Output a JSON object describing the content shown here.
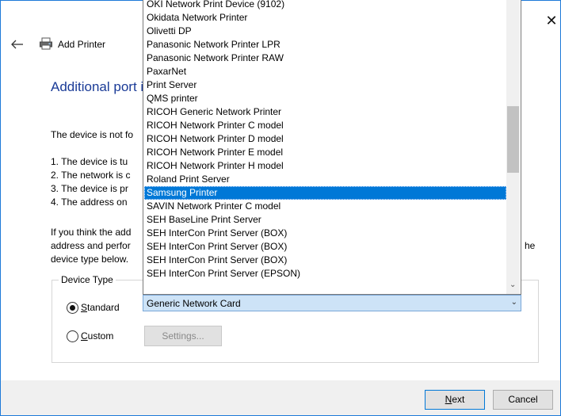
{
  "window": {
    "title": "Add Printer",
    "close_glyph": "✕",
    "back_glyph": "←"
  },
  "heading": "Additional port i",
  "paragraph1": "The device is not fo",
  "list_items": [
    "1.  The device is tu",
    "2.  The network is c",
    "3.  The device is pr",
    "4.  The address on"
  ],
  "paragraph2_lines": [
    "If you think the add",
    "address and perfor",
    "device type below."
  ],
  "paragraph2_tail": "he",
  "device_type": {
    "label": "Device Type",
    "standard_label": "Standard",
    "custom_label": "Custom",
    "selected": "standard",
    "combo_value": "Generic Network Card",
    "settings_label": "Settings..."
  },
  "dropdown_options": [
    {
      "label": "OKI Network Print Device (9102)",
      "selected": false
    },
    {
      "label": "Okidata Network Printer",
      "selected": false
    },
    {
      "label": "Olivetti DP",
      "selected": false
    },
    {
      "label": "Panasonic Network Printer LPR",
      "selected": false
    },
    {
      "label": "Panasonic Network Printer RAW",
      "selected": false
    },
    {
      "label": "PaxarNet",
      "selected": false
    },
    {
      "label": "Print Server",
      "selected": false
    },
    {
      "label": "QMS printer",
      "selected": false
    },
    {
      "label": "RICOH Generic Network Printer",
      "selected": false
    },
    {
      "label": "RICOH Network Printer C model",
      "selected": false
    },
    {
      "label": "RICOH Network Printer D model",
      "selected": false
    },
    {
      "label": "RICOH Network Printer E model",
      "selected": false
    },
    {
      "label": "RICOH Network Printer H model",
      "selected": false
    },
    {
      "label": "Roland Print Server",
      "selected": false
    },
    {
      "label": "Samsung Printer",
      "selected": true
    },
    {
      "label": "SAVIN Network Printer C model",
      "selected": false
    },
    {
      "label": "SEH BaseLine Print Server",
      "selected": false
    },
    {
      "label": "SEH InterCon Print Server (BOX)",
      "selected": false
    },
    {
      "label": "SEH InterCon Print Server (BOX)",
      "selected": false
    },
    {
      "label": "SEH InterCon Print Server (BOX)",
      "selected": false
    },
    {
      "label": "SEH InterCon Print Server (EPSON)",
      "selected": false
    }
  ],
  "buttons": {
    "next": "Next",
    "cancel": "Cancel"
  },
  "colors": {
    "heading": "#1a3b97",
    "selection": "#0078d7",
    "window_border": "#1e7ad8"
  }
}
